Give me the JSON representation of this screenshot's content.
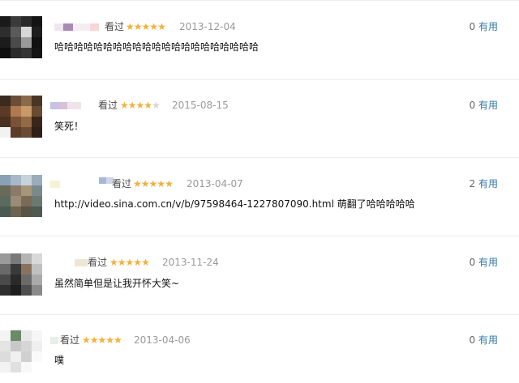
{
  "reviews": [
    {
      "verb": "看过",
      "rating": 5,
      "date": "2013-12-04",
      "useful_count": "0",
      "useful_label": "有用",
      "comment": "哈哈哈哈哈哈哈哈哈哈哈哈哈哈哈哈哈哈哈哈哈"
    },
    {
      "verb": "看过",
      "rating": 4,
      "date": "2015-08-15",
      "useful_count": "0",
      "useful_label": "有用",
      "comment": "笑死！"
    },
    {
      "verb": "看过",
      "rating": 5,
      "date": "2013-04-07",
      "useful_count": "2",
      "useful_label": "有用",
      "comment": "http://video.sina.com.cn/v/b/97598464-1227807090.html 萌翻了哈哈哈哈哈"
    },
    {
      "verb": "看过",
      "rating": 5,
      "date": "2013-11-24",
      "useful_count": "0",
      "useful_label": "有用",
      "comment": "虽然简单但是让我开怀大笑~"
    },
    {
      "verb": "看过",
      "rating": 5,
      "date": "2013-04-06",
      "useful_count": "0",
      "useful_label": "有用",
      "comment": "噗"
    }
  ]
}
